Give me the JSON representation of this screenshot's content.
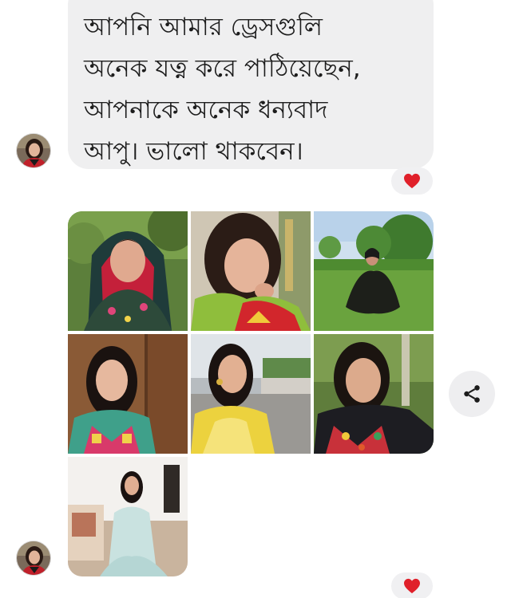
{
  "messages": [
    {
      "sender_avatar": "avatar-woman-red-dress",
      "text": "আপনি আমার ড্রেসগুলি\nঅনেক যত্ন করে পাঠিয়েছেন,\nআপনাকে অনেক ধন্যবাদ\nআপু। ভালো থাকবেন।",
      "reaction": "heart-icon"
    },
    {
      "sender_avatar": "avatar-woman-red-dress",
      "type": "photo-album",
      "photo_count": 7,
      "photos": [
        {
          "description_icon": "photo-red-scarf-garden"
        },
        {
          "description_icon": "photo-green-red-shawl-smile"
        },
        {
          "description_icon": "photo-seated-in-field"
        },
        {
          "description_icon": "photo-embroidered-kurta-indoors"
        },
        {
          "description_icon": "photo-yellow-dupatta-rooftop"
        },
        {
          "description_icon": "photo-black-embroidered-kurta-outdoors"
        },
        {
          "description_icon": "photo-white-dress-sofa"
        }
      ],
      "reaction": "heart-icon"
    }
  ],
  "actions": {
    "share_icon": "share-icon"
  },
  "colors": {
    "bubble_bg": "#efeff0",
    "reaction_bg": "#f0f0f2",
    "heart": "#e0202a",
    "text": "#1c1c1c"
  }
}
